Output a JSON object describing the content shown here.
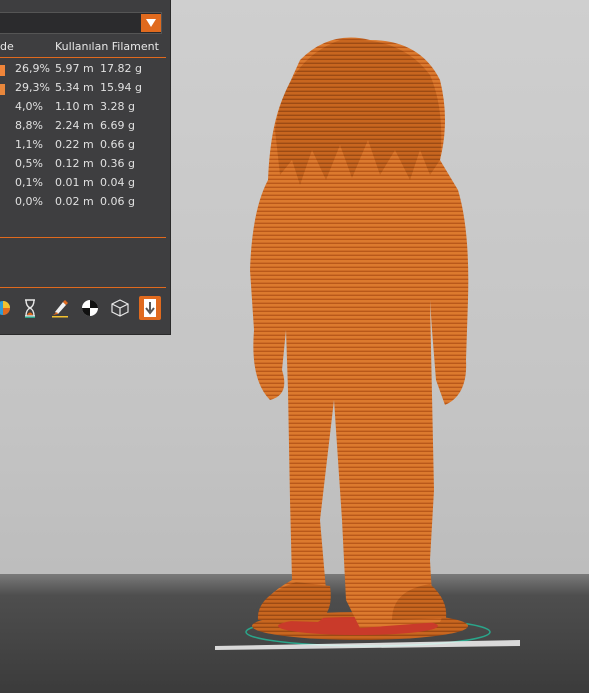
{
  "stats_table": {
    "col_left_header": "de",
    "col_right_header": "Kullanılan Filament",
    "rows": [
      {
        "pct": "26,9%",
        "length": "5.97 m",
        "weight": "17.82 g",
        "swatch": "#f0853a"
      },
      {
        "pct": "29,3%",
        "length": "5.34 m",
        "weight": "15.94 g",
        "swatch": "#e9873c"
      },
      {
        "pct": "4,0%",
        "length": "1.10 m",
        "weight": "3.28 g",
        "swatch": ""
      },
      {
        "pct": "8,8%",
        "length": "2.24 m",
        "weight": "6.69 g",
        "swatch": ""
      },
      {
        "pct": "1,1%",
        "length": "0.22 m",
        "weight": "0.66 g",
        "swatch": ""
      },
      {
        "pct": "0,5%",
        "length": "0.12 m",
        "weight": "0.36 g",
        "swatch": ""
      },
      {
        "pct": "0,1%",
        "length": "0.01 m",
        "weight": "0.04 g",
        "swatch": ""
      },
      {
        "pct": "0,0%",
        "length": "0.02 m",
        "weight": "0.06 g",
        "swatch": ""
      }
    ]
  },
  "toolbar": {
    "buttons": [
      {
        "icon": "color-wheel-icon"
      },
      {
        "icon": "hourglass-icon"
      },
      {
        "icon": "paint-brush-icon"
      },
      {
        "icon": "contrast-circle-icon"
      },
      {
        "icon": "wireframe-cube-icon"
      },
      {
        "icon": "download-arrow-icon",
        "active": true
      }
    ]
  },
  "colors": {
    "accent": "#e06a1e",
    "panel_bg": "#3e3e40",
    "model": "#d9772c"
  }
}
